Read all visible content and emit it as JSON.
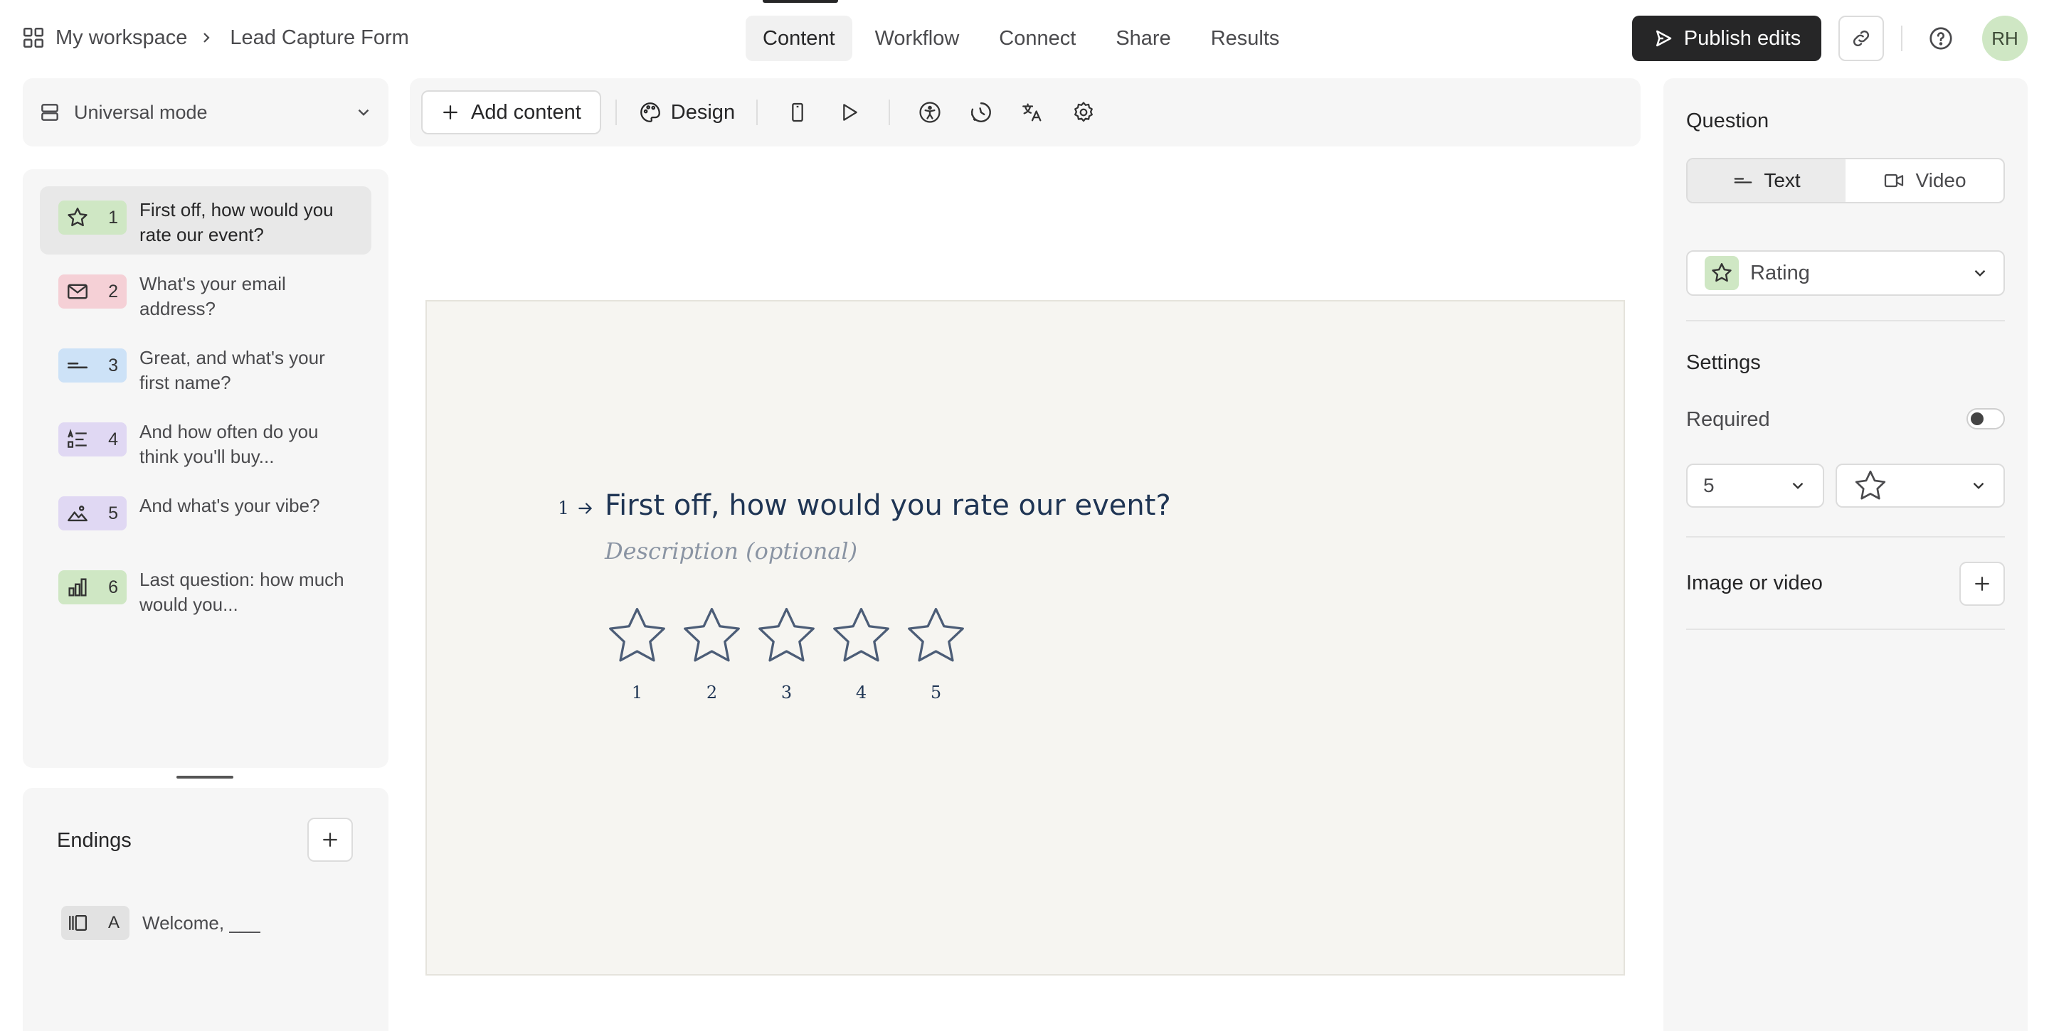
{
  "breadcrumb": {
    "workspace": "My workspace",
    "form": "Lead Capture Form"
  },
  "nav": {
    "tabs": [
      "Content",
      "Workflow",
      "Connect",
      "Share",
      "Results"
    ],
    "active": "Content"
  },
  "actions": {
    "publish_label": "Publish edits",
    "avatar_initials": "RH"
  },
  "left": {
    "mode_label": "Universal mode",
    "questions": [
      {
        "num": "1",
        "text": "First off, how would you rate our event?",
        "icon": "star-icon",
        "color": "#cfe7c4"
      },
      {
        "num": "2",
        "text": "What's your email address?",
        "icon": "envelope-icon",
        "color": "#f5d0d6"
      },
      {
        "num": "3",
        "text": "Great, and what's your first name?",
        "icon": "short-text-icon",
        "color": "#cde2f7"
      },
      {
        "num": "4",
        "text": "And how often do you think you'll buy...",
        "icon": "multiple-choice-icon",
        "color": "#e0d8f3"
      },
      {
        "num": "5",
        "text": "And what's your vibe?",
        "icon": "picture-choice-icon",
        "color": "#e0d8f3"
      },
      {
        "num": "6",
        "text": "Last question: how much would you...",
        "icon": "opinion-scale-icon",
        "color": "#cfe7c4"
      }
    ],
    "endings_title": "Endings",
    "ending": {
      "letter": "A",
      "text": "Welcome, ___"
    }
  },
  "toolbar": {
    "add_content": "Add content",
    "design": "Design"
  },
  "canvas": {
    "question_number": "1",
    "title": "First off, how would you rate our event?",
    "description_placeholder": "Description (optional)",
    "rating_labels": [
      "1",
      "2",
      "3",
      "4",
      "5"
    ]
  },
  "right": {
    "question_heading": "Question",
    "segments": [
      "Text",
      "Video"
    ],
    "active_segment": "Text",
    "type_label": "Rating",
    "settings_heading": "Settings",
    "required_label": "Required",
    "required_on": false,
    "steps_value": "5",
    "shape_value": "star",
    "media_label": "Image or video"
  },
  "colors": {
    "accent_dark": "#262627",
    "canvas_bg": "#f6f5f1",
    "question_text": "#1f3554"
  }
}
